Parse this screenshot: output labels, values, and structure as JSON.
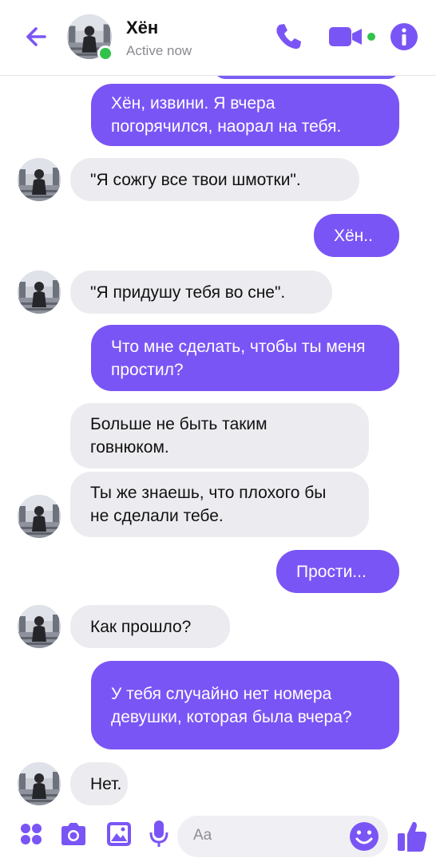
{
  "header": {
    "contact_name": "Хён",
    "status": "Active now",
    "icons": [
      "back-arrow-icon",
      "phone-icon",
      "video-camera-icon",
      "info-icon"
    ]
  },
  "messages": [
    {
      "dir": "out",
      "text": "Хён, извини. Я вчера погорячился, наорал на тебя."
    },
    {
      "dir": "in",
      "text": "\"Я сожгу все твои шмотки\"."
    },
    {
      "dir": "out",
      "text": "Хён.."
    },
    {
      "dir": "in",
      "text": "\"Я придушу тебя во сне\"."
    },
    {
      "dir": "out",
      "text": "Что мне сделать, чтобы ты меня простил?"
    },
    {
      "dir": "in",
      "text": "Больше не быть таким говнюком."
    },
    {
      "dir": "in",
      "text": "Ты же знаешь, что плохого бы не сделали тебе."
    },
    {
      "dir": "out",
      "text": "Прости..."
    },
    {
      "dir": "in",
      "text": "Как прошло?"
    },
    {
      "dir": "out",
      "text": "У тебя случайно нет номера девушки, которая была вчера?"
    },
    {
      "dir": "in",
      "text": "Нет."
    }
  ],
  "composer": {
    "placeholder": "Aa",
    "icons": [
      "apps-dots-icon",
      "camera-icon",
      "image-icon",
      "microphone-icon",
      "emoji-icon",
      "thumbs-up-icon"
    ]
  },
  "colors": {
    "accent": "#7a55f5",
    "incoming": "#ececf0",
    "online": "#30c24b"
  }
}
